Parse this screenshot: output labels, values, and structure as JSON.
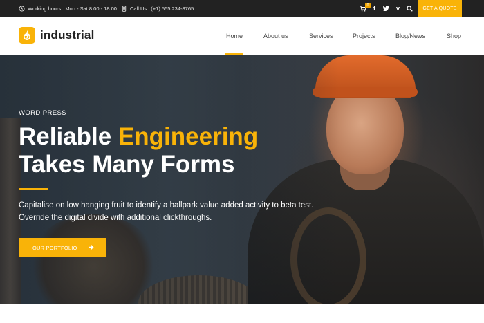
{
  "topbar": {
    "hours_label": "Working hours:",
    "hours_value": "Mon - Sat 8.00 - 18.00",
    "phone_label": "Call Us:",
    "phone_value": "(+1) 555 234-8765",
    "cart_count": "0",
    "social_icons": [
      "cart-icon",
      "facebook-icon",
      "twitter-icon",
      "vimeo-icon",
      "search-icon"
    ],
    "quote_button": "GET A QUOTE"
  },
  "header": {
    "logo_text": "industrial",
    "nav": [
      "Home",
      "About us",
      "Services",
      "Projects",
      "Blog/News",
      "Shop"
    ],
    "active_nav": "Home"
  },
  "hero": {
    "eyebrow": "WORD PRESS",
    "headline_part1": "Reliable ",
    "headline_highlight": "Engineering",
    "headline_line2": "Takes Many Forms",
    "description": "Capitalise on low hanging fruit to identify a ballpark value added activity to beta test. Override the digital divide with additional clickthroughs.",
    "cta_label": "OUR PORTFOLIO"
  },
  "colors": {
    "accent": "#f9b308",
    "topbar_bg": "#222222",
    "text_dark": "#222222"
  }
}
